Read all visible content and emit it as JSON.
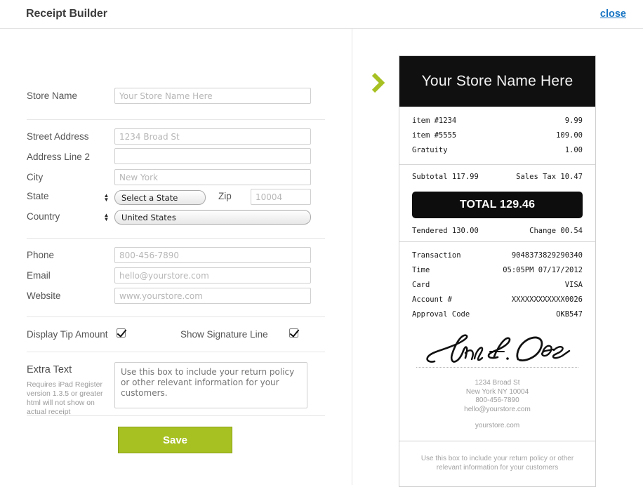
{
  "header": {
    "title": "Receipt Builder",
    "close_label": "close"
  },
  "form": {
    "store_name": {
      "label": "Store Name",
      "placeholder": "Your Store Name Here",
      "value": ""
    },
    "street_address": {
      "label": "Street Address",
      "placeholder": "1234 Broad St",
      "value": ""
    },
    "address_line_2": {
      "label": "Address Line 2",
      "placeholder": "",
      "value": ""
    },
    "city": {
      "label": "City",
      "placeholder": "New York",
      "value": ""
    },
    "state": {
      "label": "State",
      "selected": "Select a State",
      "options": [
        "Select a State"
      ]
    },
    "zip": {
      "label": "Zip",
      "placeholder": "10004",
      "value": ""
    },
    "country": {
      "label": "Country",
      "selected": "United States",
      "options": [
        "United States"
      ]
    },
    "phone": {
      "label": "Phone",
      "placeholder": "800-456-7890",
      "value": ""
    },
    "email": {
      "label": "Email",
      "placeholder": "hello@yourstore.com",
      "value": ""
    },
    "website": {
      "label": "Website",
      "placeholder": "www.yourstore.com",
      "value": ""
    },
    "display_tip": {
      "label": "Display Tip Amount",
      "checked": true
    },
    "show_signature": {
      "label": "Show Signature Line",
      "checked": true
    },
    "extra_text": {
      "label": "Extra Text",
      "note": "Requires iPad Register version 1.3.5 or greater html will not show on actual receipt",
      "placeholder": "Use this box to include your return policy or other relevant information for your customers.",
      "value": ""
    },
    "save_label": "Save"
  },
  "receipt": {
    "store_name": "Your Store Name Here",
    "items": [
      {
        "name": "item #1234",
        "amount": "9.99"
      },
      {
        "name": "item #5555",
        "amount": "109.00"
      },
      {
        "name": "Gratuity",
        "amount": "1.00"
      }
    ],
    "subtotal": "Subtotal 117.99",
    "sales_tax": "Sales Tax 10.47",
    "total": "TOTAL 129.46",
    "tendered": "Tendered 130.00",
    "change": "Change 00.54",
    "details": [
      {
        "label": "Transaction",
        "value": "9048373829290340"
      },
      {
        "label": "Time",
        "value": "05:05PM 07/17/2012"
      },
      {
        "label": "Card",
        "value": "VISA"
      },
      {
        "label": "Account #",
        "value": "XXXXXXXXXXXX0026"
      },
      {
        "label": "Approval Code",
        "value": "OKB547"
      }
    ],
    "signature_name": "John E. Doe",
    "address_lines": [
      "1234 Broad St",
      "New York NY 10004",
      "800-456-7890",
      "hello@yourstore.com"
    ],
    "website": "yourstore.com",
    "footer_text": "Use this box to include your return policy or other relevant information for your customers"
  },
  "colors": {
    "accent_green": "#a7c022",
    "link_blue": "#1a76c4",
    "receipt_black": "#101010"
  }
}
